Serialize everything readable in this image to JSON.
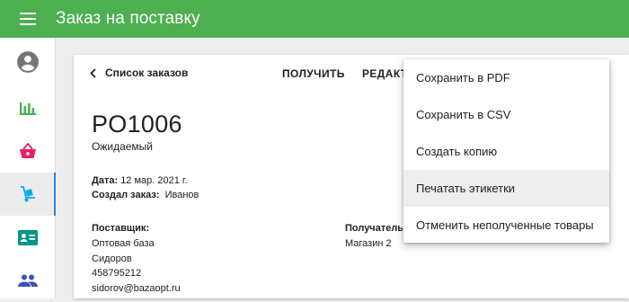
{
  "appbar": {
    "title": "Заказ на поставку",
    "menu_icon": "hamburger-menu-icon",
    "color": "#4caf50"
  },
  "sidebar": {
    "items": [
      {
        "name": "account",
        "icon": "account-circle-icon",
        "color": "#757575",
        "active": false
      },
      {
        "name": "reports",
        "icon": "bar-chart-icon",
        "color": "#4caf50",
        "active": false
      },
      {
        "name": "sales",
        "icon": "basket-icon",
        "color": "#e91e63",
        "active": false
      },
      {
        "name": "purchases",
        "icon": "hand-truck-icon",
        "color": "#03a9f4",
        "active": true
      },
      {
        "name": "contacts",
        "icon": "contact-card-icon",
        "color": "#009688",
        "active": false
      },
      {
        "name": "users",
        "icon": "people-icon",
        "color": "#3f51b5",
        "active": false
      }
    ]
  },
  "toolbar": {
    "back_label": "Список заказов",
    "receive_label": "ПОЛУЧИТЬ",
    "edit_label": "РЕДАКТ"
  },
  "order": {
    "number": "PO1006",
    "status": "Ожидаемый",
    "date_label": "Дата:",
    "date_value": "12 мар. 2021 г.",
    "creator_label": "Создал заказ:",
    "creator_value": "Иванов"
  },
  "supplier": {
    "label": "Поставщик:",
    "name": "Оптовая база",
    "contact": "Сидоров",
    "phone": "458795212",
    "email": "sidorov@bazaopt.ru"
  },
  "recipient": {
    "label": "Получатель",
    "name": "Магазин 2"
  },
  "menu": {
    "items": [
      {
        "label": "Сохранить в PDF",
        "highlighted": false
      },
      {
        "label": "Сохранить в CSV",
        "highlighted": false
      },
      {
        "label": "Создать копию",
        "highlighted": false
      },
      {
        "label": "Печатать этикетки",
        "highlighted": true
      },
      {
        "label": "Отменить неполученные товары",
        "highlighted": false
      }
    ]
  }
}
